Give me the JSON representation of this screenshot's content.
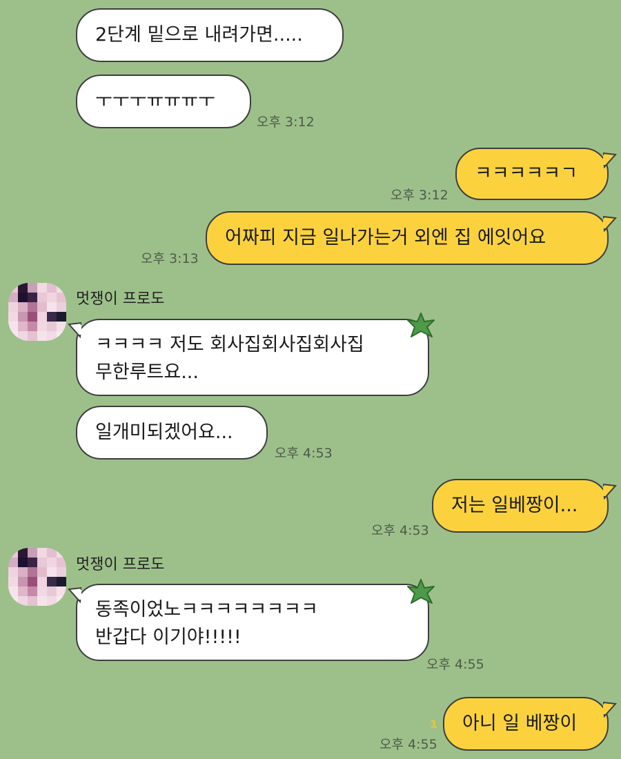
{
  "messages": {
    "m1": {
      "text": "2단계 밑으로 내려가면....."
    },
    "m2": {
      "text": "ㅜㅜㅜㅠㅠㅠㅜ",
      "time": "오후 3:12"
    },
    "m3": {
      "text": "ㅋㅋㅋㅋㅋㄱ",
      "time": "오후 3:12"
    },
    "m4": {
      "text": "어짜피 지금 일나가는거 외엔 집 에잇어요",
      "time": "오후 3:13"
    },
    "sender1": {
      "name": "멋쟁이 프로도"
    },
    "m5": {
      "line1": "ㅋㅋㅋㅋ 저도 회사집회사집회사집",
      "line2": "무한루트요..."
    },
    "m6": {
      "text": "일개미되겠어요...",
      "time": "오후 4:53"
    },
    "m7": {
      "text": "저는 일베짱이...",
      "time": "오후 4:53"
    },
    "sender2": {
      "name": "멋쟁이 프로도"
    },
    "m8": {
      "line1": "동족이었노ㅋㅋㅋㅋㅋㅋㅋㅋ",
      "line2": "반갑다 이기야!!!!!",
      "time": "오후 4:55"
    },
    "m9": {
      "text": "아니 일 베짱이",
      "time": "오후 4:55",
      "unread": "1"
    }
  },
  "colors": {
    "background": "#9dc08b",
    "incoming_bubble": "#ffffff",
    "outgoing_bubble": "#fbd23e",
    "border": "#3d3d3d"
  }
}
